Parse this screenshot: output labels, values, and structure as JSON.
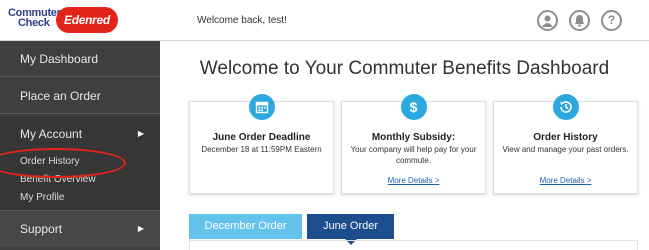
{
  "brand": {
    "logo_line1": "Commuter",
    "logo_line2": "Check",
    "logo_badge": "Edenred",
    "badge_color": "#e2231a"
  },
  "header": {
    "welcome": "Welcome back, test!",
    "icons": [
      "user-icon",
      "bell-icon",
      "help-icon"
    ],
    "help_glyph": "?"
  },
  "sidebar": {
    "items": [
      {
        "label": "My Dashboard"
      },
      {
        "label": "Place an Order"
      },
      {
        "label": "My Account",
        "has_caret": true
      },
      {
        "label": "Support",
        "has_caret": true
      }
    ],
    "account_subitems": [
      {
        "label": "Order History",
        "highlighted": true
      },
      {
        "label": "Benefit Overview"
      },
      {
        "label": "My Profile"
      }
    ]
  },
  "main": {
    "title": "Welcome to Your Commuter Benefits Dashboard",
    "cards": [
      {
        "icon": "calendar-icon",
        "title": "June Order Deadline",
        "body": "December 18 at 11:59PM Eastern",
        "link": ""
      },
      {
        "icon": "dollar-icon",
        "title": "Monthly Subsidy:",
        "body": "Your company will help pay for your commute.",
        "link": "More Details >"
      },
      {
        "icon": "history-icon",
        "title": "Order History",
        "body": "View and manage your past orders.",
        "link": "More Details >"
      }
    ],
    "tabs": [
      {
        "label": "December Order",
        "active": false
      },
      {
        "label": "June Order",
        "active": true
      }
    ]
  },
  "colors": {
    "accent_blue": "#2ba8dd",
    "tab_active": "#1c4d8c",
    "tab_inactive": "#64c3ea",
    "sidebar_bg": "#3f3f3f",
    "link": "#1f5fb0"
  }
}
